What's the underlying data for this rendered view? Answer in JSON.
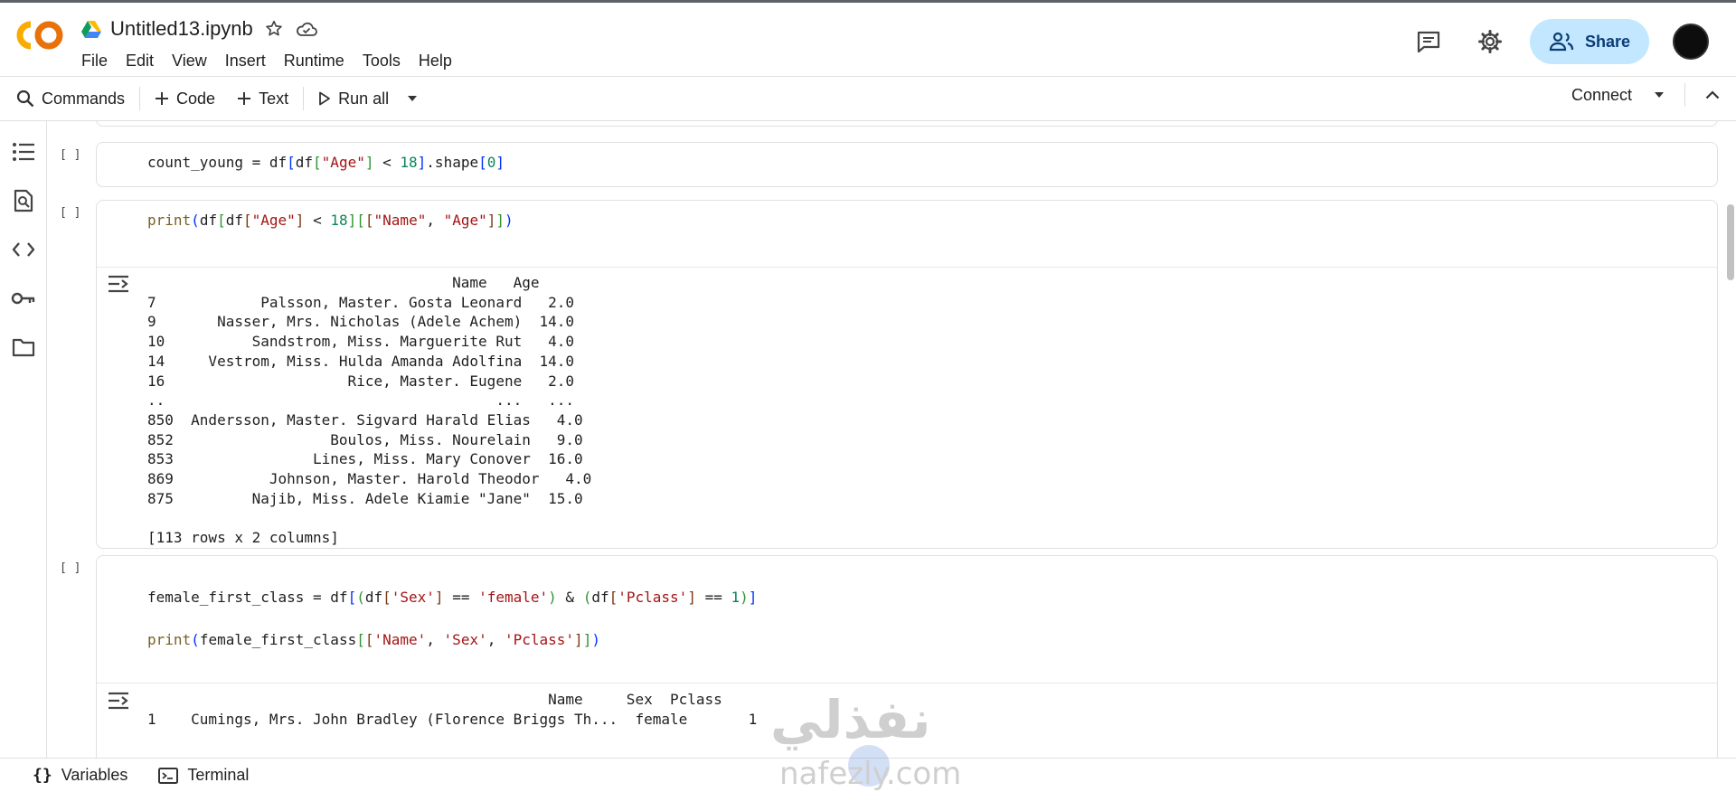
{
  "app": {
    "notebook_title": "Untitled13.ipynb",
    "menu": [
      "File",
      "Edit",
      "View",
      "Insert",
      "Runtime",
      "Tools",
      "Help"
    ],
    "share_label": "Share"
  },
  "toolbar": {
    "commands_label": "Commands",
    "code_label": "Code",
    "text_label": "Text",
    "run_all_label": "Run all",
    "connect_label": "Connect"
  },
  "cells": {
    "cell1": {
      "run_indicator": "[ ]",
      "code": "count_young = df[df[\"Age\"] < 18].shape[0]"
    },
    "cell2": {
      "run_indicator": "[ ]",
      "code": "print(df[df[\"Age\"] < 18][[\"Name\", \"Age\"]])",
      "output": "                                   Name   Age\n7            Palsson, Master. Gosta Leonard   2.0\n9       Nasser, Mrs. Nicholas (Adele Achem)  14.0\n10          Sandstrom, Miss. Marguerite Rut   4.0\n14     Vestrom, Miss. Hulda Amanda Adolfina  14.0\n16                     Rice, Master. Eugene   2.0\n..                                      ...   ...\n850  Andersson, Master. Sigvard Harald Elias   4.0\n852                  Boulos, Miss. Nourelain   9.0\n853                Lines, Miss. Mary Conover  16.0\n869           Johnson, Master. Harold Theodor   4.0\n875         Najib, Miss. Adele Kiamie \"Jane\"  15.0\n\n[113 rows x 2 columns]"
    },
    "cell3": {
      "run_indicator": "[ ]",
      "code_line1": "female_first_class = df[(df['Sex'] == 'female') & (df['Pclass'] == 1)]",
      "code_line2": "print(female_first_class[['Name', 'Sex', 'Pclass']])",
      "output": "                                              Name     Sex  Pclass\n1    Cumings, Mrs. John Bradley (Florence Briggs Th...  female       1"
    }
  },
  "statusbar": {
    "variables_label": "Variables",
    "terminal_label": "Terminal"
  },
  "watermark": {
    "arabic": "نفذلي",
    "latin": "nafezly.com"
  },
  "colors": {
    "share_bg": "#c2e7ff",
    "logo_orange": "#f9ab00",
    "logo_dark_orange": "#e8710a"
  }
}
